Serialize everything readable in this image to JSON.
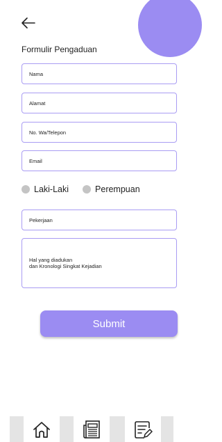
{
  "header": {
    "back_icon": "arrow-left-icon",
    "title": "Formulir Pengaduan",
    "accent_color": "#9b8cf2"
  },
  "form": {
    "nama_placeholder": "Nama",
    "alamat_placeholder": "Alamat",
    "phone_placeholder": "No. Wa/Telepon",
    "email_placeholder": "Email",
    "gender_options": [
      "Laki-Laki",
      "Perempuan"
    ],
    "pekerjaan_placeholder": "Pekerjaan",
    "complaint_line1": "Hal yang diadukan",
    "complaint_line2": "dan Kronologi Singkat Kejadian",
    "submit_label": "Submit"
  },
  "bottom_nav": {
    "items": [
      {
        "icon": "home-icon"
      },
      {
        "icon": "news-icon"
      },
      {
        "icon": "edit-note-icon"
      }
    ]
  }
}
